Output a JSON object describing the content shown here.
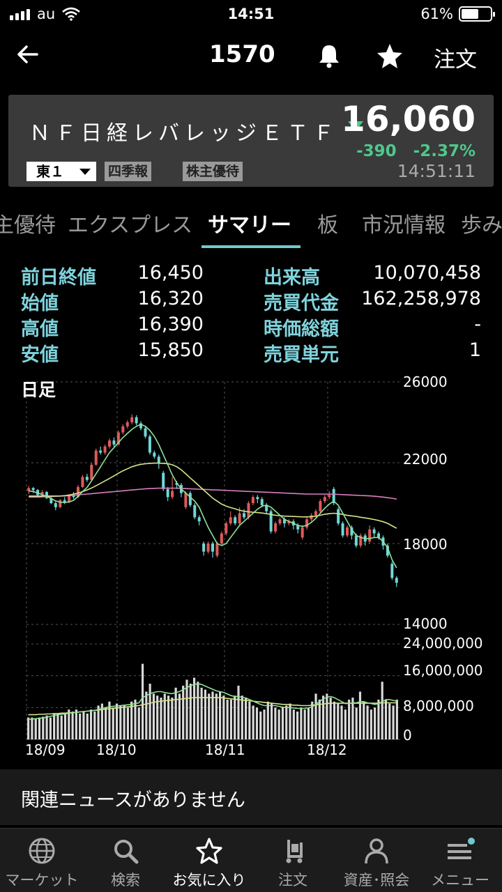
{
  "status_bar": {
    "carrier": "au",
    "time": "14:51",
    "battery": "61%",
    "battery_level": 0.61
  },
  "nav": {
    "code": "1570",
    "order_label": "注文"
  },
  "stock": {
    "name": "ＮＦ日経レバレッジＥＴＦ",
    "price": "16,060",
    "change": "-390",
    "change_pct": "-2.37%",
    "timestamp": "14:51:11",
    "market": "東１",
    "tags": [
      "四季報",
      "株主優待"
    ],
    "down_color": "#4fc88e"
  },
  "tabs": [
    "主優待",
    "エクスプレス",
    "サマリー",
    "板",
    "市況情報",
    "歩み"
  ],
  "active_tab": "サマリー",
  "summary": {
    "left": [
      {
        "label": "前日終値",
        "value": "16,450"
      },
      {
        "label": "始値",
        "value": "16,320"
      },
      {
        "label": "高値",
        "value": "16,390"
      },
      {
        "label": "安値",
        "value": "15,850"
      }
    ],
    "right": [
      {
        "label": "出来高",
        "value": "10,070,458"
      },
      {
        "label": "売買代金",
        "value": "162,258,978"
      },
      {
        "label": "時価総額",
        "value": "-"
      },
      {
        "label": "売買単元",
        "value": "1"
      }
    ]
  },
  "chart_data": {
    "type": "candlestick",
    "title": "日足",
    "price_ticks": [
      "26000",
      "22000",
      "18000",
      "14000"
    ],
    "price_ylim": [
      14000,
      26000
    ],
    "volume_ticks": [
      "24,000,000",
      "16,000,000",
      "8,000,000",
      "0"
    ],
    "volume_ylim": [
      0,
      24000000
    ],
    "x_labels": [
      "18/09",
      "18/10",
      "18/11",
      "18/12"
    ],
    "up_color": "#e05a5a",
    "down_color": "#72d6d6",
    "ma_colors": [
      "#8fe39a",
      "#d8e48a",
      "#d97fbf"
    ],
    "candles": [
      {
        "o": 20600,
        "c": 20750,
        "h": 20850,
        "l": 20450
      },
      {
        "o": 20750,
        "c": 20650,
        "h": 20800,
        "l": 20500
      },
      {
        "o": 20650,
        "c": 20400,
        "h": 20700,
        "l": 20300
      },
      {
        "o": 20400,
        "c": 20550,
        "h": 20650,
        "l": 20350
      },
      {
        "o": 20550,
        "c": 20250,
        "h": 20600,
        "l": 20200
      },
      {
        "o": 20250,
        "c": 20000,
        "h": 20300,
        "l": 19950
      },
      {
        "o": 20000,
        "c": 19800,
        "h": 20100,
        "l": 19650
      },
      {
        "o": 19800,
        "c": 20150,
        "h": 20200,
        "l": 19750
      },
      {
        "o": 20150,
        "c": 20050,
        "h": 20300,
        "l": 19950
      },
      {
        "o": 20050,
        "c": 20400,
        "h": 20450,
        "l": 20000
      },
      {
        "o": 20400,
        "c": 20300,
        "h": 20550,
        "l": 20200
      },
      {
        "o": 20300,
        "c": 20800,
        "h": 20900,
        "l": 20250
      },
      {
        "o": 20800,
        "c": 21300,
        "h": 21400,
        "l": 20750
      },
      {
        "o": 21300,
        "c": 21150,
        "h": 21450,
        "l": 21050
      },
      {
        "o": 21150,
        "c": 21900,
        "h": 22000,
        "l": 21100
      },
      {
        "o": 21900,
        "c": 22600,
        "h": 22700,
        "l": 21850
      },
      {
        "o": 22600,
        "c": 22500,
        "h": 22800,
        "l": 22400
      },
      {
        "o": 22500,
        "c": 22800,
        "h": 22900,
        "l": 22400
      },
      {
        "o": 22800,
        "c": 23100,
        "h": 23200,
        "l": 22700
      },
      {
        "o": 23100,
        "c": 22900,
        "h": 23250,
        "l": 22800
      },
      {
        "o": 22900,
        "c": 23500,
        "h": 23600,
        "l": 22850
      },
      {
        "o": 23500,
        "c": 23800,
        "h": 23900,
        "l": 23400
      },
      {
        "o": 23800,
        "c": 24000,
        "h": 24100,
        "l": 23700
      },
      {
        "o": 24000,
        "c": 24250,
        "h": 24400,
        "l": 23900
      },
      {
        "o": 24250,
        "c": 23950,
        "h": 24350,
        "l": 23850
      },
      {
        "o": 23950,
        "c": 23700,
        "h": 24050,
        "l": 23600
      },
      {
        "o": 23700,
        "c": 23300,
        "h": 23800,
        "l": 23200
      },
      {
        "o": 23300,
        "c": 22500,
        "h": 23400,
        "l": 22400
      },
      {
        "o": 22500,
        "c": 22300,
        "h": 22600,
        "l": 22200
      },
      {
        "o": 22300,
        "c": 22000,
        "h": 22400,
        "l": 21700
      },
      {
        "o": 21500,
        "c": 20700,
        "h": 21600,
        "l": 20600
      },
      {
        "o": 20700,
        "c": 20300,
        "h": 20800,
        "l": 20100
      },
      {
        "o": 20300,
        "c": 20600,
        "h": 21300,
        "l": 20200
      },
      {
        "o": 21000,
        "c": 20900,
        "h": 21100,
        "l": 20700
      },
      {
        "o": 20900,
        "c": 20500,
        "h": 21000,
        "l": 20300
      },
      {
        "o": 19800,
        "c": 20500,
        "h": 20600,
        "l": 19700
      },
      {
        "o": 20500,
        "c": 19900,
        "h": 20600,
        "l": 19800
      },
      {
        "o": 19900,
        "c": 19300,
        "h": 20000,
        "l": 19200
      },
      {
        "o": 19300,
        "c": 19100,
        "h": 19400,
        "l": 18900
      },
      {
        "o": 18000,
        "c": 17600,
        "h": 18100,
        "l": 17400
      },
      {
        "o": 17600,
        "c": 18000,
        "h": 18100,
        "l": 17500
      },
      {
        "o": 18000,
        "c": 17600,
        "h": 18100,
        "l": 17300
      },
      {
        "o": 17400,
        "c": 18000,
        "h": 18100,
        "l": 17300
      },
      {
        "o": 18000,
        "c": 18500,
        "h": 18600,
        "l": 17900
      },
      {
        "o": 18500,
        "c": 19000,
        "h": 19100,
        "l": 18400
      },
      {
        "o": 19000,
        "c": 19300,
        "h": 19600,
        "l": 18900
      },
      {
        "o": 19300,
        "c": 19000,
        "h": 19400,
        "l": 18900
      },
      {
        "o": 19000,
        "c": 19500,
        "h": 19800,
        "l": 18900
      },
      {
        "o": 19500,
        "c": 19300,
        "h": 19700,
        "l": 19200
      },
      {
        "o": 19300,
        "c": 20000,
        "h": 20100,
        "l": 19200
      },
      {
        "o": 20000,
        "c": 20300,
        "h": 20400,
        "l": 19900
      },
      {
        "o": 20300,
        "c": 20200,
        "h": 20400,
        "l": 20000
      },
      {
        "o": 20200,
        "c": 19900,
        "h": 20300,
        "l": 19800
      },
      {
        "o": 19900,
        "c": 19600,
        "h": 20000,
        "l": 19500
      },
      {
        "o": 19600,
        "c": 18600,
        "h": 19700,
        "l": 18500
      },
      {
        "o": 18600,
        "c": 19000,
        "h": 19100,
        "l": 18500
      },
      {
        "o": 19000,
        "c": 19200,
        "h": 19300,
        "l": 18900
      },
      {
        "o": 19200,
        "c": 19000,
        "h": 19300,
        "l": 18800
      },
      {
        "o": 19000,
        "c": 19100,
        "h": 19200,
        "l": 18900
      },
      {
        "o": 19100,
        "c": 18900,
        "h": 19200,
        "l": 18700
      },
      {
        "o": 18900,
        "c": 18700,
        "h": 19000,
        "l": 18500
      },
      {
        "o": 18300,
        "c": 18800,
        "h": 18900,
        "l": 18200
      },
      {
        "o": 18800,
        "c": 19200,
        "h": 19300,
        "l": 18700
      },
      {
        "o": 19200,
        "c": 19400,
        "h": 19500,
        "l": 19100
      },
      {
        "o": 19400,
        "c": 19600,
        "h": 19700,
        "l": 19300
      },
      {
        "o": 19600,
        "c": 20100,
        "h": 20200,
        "l": 19500
      },
      {
        "o": 20100,
        "c": 20300,
        "h": 20400,
        "l": 20000
      },
      {
        "o": 20300,
        "c": 20400,
        "h": 20600,
        "l": 20200
      },
      {
        "o": 20700,
        "c": 20000,
        "h": 20800,
        "l": 19900
      },
      {
        "o": 19700,
        "c": 19000,
        "h": 19800,
        "l": 18900
      },
      {
        "o": 19000,
        "c": 18400,
        "h": 19100,
        "l": 18300
      },
      {
        "o": 18400,
        "c": 18800,
        "h": 18900,
        "l": 18300
      },
      {
        "o": 18800,
        "c": 18400,
        "h": 18900,
        "l": 18200
      },
      {
        "o": 18400,
        "c": 17900,
        "h": 18500,
        "l": 17800
      },
      {
        "o": 17900,
        "c": 18400,
        "h": 18500,
        "l": 17800
      },
      {
        "o": 18400,
        "c": 18100,
        "h": 18500,
        "l": 17900
      },
      {
        "o": 18100,
        "c": 18700,
        "h": 18900,
        "l": 18000
      },
      {
        "o": 18700,
        "c": 18500,
        "h": 18800,
        "l": 18300
      },
      {
        "o": 18500,
        "c": 18300,
        "h": 18600,
        "l": 18200
      },
      {
        "o": 18300,
        "c": 17900,
        "h": 18400,
        "l": 17700
      },
      {
        "o": 17900,
        "c": 17400,
        "h": 18000,
        "l": 17300
      },
      {
        "o": 17000,
        "c": 16300,
        "h": 17100,
        "l": 16200
      },
      {
        "o": 16300,
        "c": 16060,
        "h": 16390,
        "l": 15850
      }
    ],
    "ma5": [
      20600,
      20580,
      20500,
      20420,
      20330,
      20230,
      20110,
      20050,
      20030,
      20060,
      20140,
      20330,
      20570,
      20780,
      21100,
      21450,
      21800,
      22150,
      22500,
      22750,
      23000,
      23250,
      23450,
      23650,
      23800,
      23900,
      23800,
      23600,
      23300,
      22900,
      22400,
      21900,
      21400,
      21000,
      20700,
      20500,
      20300,
      20100,
      19800,
      19300,
      18800,
      18400,
      18000,
      17900,
      18000,
      18300,
      18600,
      18900,
      19100,
      19300,
      19500,
      19700,
      19850,
      19900,
      19800,
      19600,
      19400,
      19200,
      19100,
      19000,
      18900,
      18850,
      18900,
      19050,
      19250,
      19500,
      19750,
      19950,
      20100,
      19900,
      19500,
      19100,
      18700,
      18400,
      18300,
      18250,
      18250,
      18300,
      18300,
      18100,
      17800,
      17200,
      16800
    ],
    "ma25": [
      20350,
      20350,
      20350,
      20350,
      20350,
      20350,
      20350,
      20350,
      20370,
      20400,
      20450,
      20500,
      20570,
      20650,
      20750,
      20860,
      20980,
      21100,
      21220,
      21350,
      21480,
      21600,
      21700,
      21800,
      21870,
      21920,
      21950,
      21970,
      21980,
      21980,
      21970,
      21950,
      21900,
      21800,
      21650,
      21450,
      21250,
      21050,
      20850,
      20650,
      20450,
      20250,
      20100,
      19950,
      19850,
      19780,
      19720,
      19650,
      19600,
      19570,
      19550,
      19530,
      19510,
      19480,
      19440,
      19400,
      19380,
      19360,
      19350,
      19340,
      19330,
      19320,
      19320,
      19330,
      19360,
      19400,
      19450,
      19480,
      19500,
      19480,
      19440,
      19400,
      19370,
      19340,
      19300,
      19270,
      19230,
      19190,
      19140,
      19080,
      19000,
      18880,
      18760
    ],
    "ma75": [
      20300,
      20300,
      20300,
      20310,
      20320,
      20330,
      20340,
      20350,
      20360,
      20370,
      20390,
      20410,
      20430,
      20450,
      20470,
      20490,
      20510,
      20530,
      20550,
      20570,
      20590,
      20610,
      20630,
      20650,
      20670,
      20690,
      20710,
      20720,
      20730,
      20740,
      20740,
      20740,
      20740,
      20740,
      20730,
      20720,
      20710,
      20700,
      20690,
      20680,
      20670,
      20660,
      20650,
      20640,
      20630,
      20620,
      20610,
      20600,
      20590,
      20580,
      20570,
      20560,
      20550,
      20540,
      20530,
      20520,
      20510,
      20500,
      20490,
      20480,
      20470,
      20460,
      20450,
      20450,
      20450,
      20450,
      20450,
      20450,
      20440,
      20430,
      20420,
      20410,
      20400,
      20390,
      20380,
      20370,
      20360,
      20340,
      20320,
      20300,
      20270,
      20240,
      20200
    ],
    "volumes": [
      5.5,
      5.5,
      5.2,
      5.5,
      5.7,
      6.0,
      5.5,
      6.5,
      6.5,
      6.0,
      6.5,
      7.5,
      7.0,
      7.5,
      6.5,
      7.0,
      6.5,
      7.5,
      7.0,
      8.5,
      9.0,
      8.0,
      9.5,
      8.0,
      9.0,
      8.5,
      8.5,
      8.0,
      9.5,
      10.0,
      8.0,
      19.0,
      12.0,
      14.0,
      11.5,
      11.0,
      10.5,
      11.5,
      11.0,
      10.5,
      13.0,
      11.5,
      13.5,
      15.0,
      14.0,
      15.5,
      14.5,
      13.0,
      12.5,
      11.5,
      12.0,
      11.5,
      12.0,
      11.0,
      10.0,
      10.0,
      11.0,
      13.5,
      11.0,
      10.5,
      9.5,
      8.5,
      8.0,
      7.0,
      7.5,
      9.5,
      9.0,
      8.0,
      7.5,
      8.0,
      8.5,
      9.0,
      7.5,
      7.0,
      8.0,
      7.5,
      8.0,
      9.5,
      11.5,
      10.0,
      11.0,
      11.5,
      10.5,
      9.5,
      9.0,
      8.5,
      7.5,
      10.0,
      10.5,
      8.0,
      12.0,
      9.5,
      8.5,
      7.5,
      8.0,
      10.0,
      14.5,
      10.0,
      9.0,
      8.5,
      10.0
    ],
    "vol_ma_short": [
      5.0,
      5.1,
      5.2,
      5.3,
      5.4,
      5.6,
      5.8,
      6.0,
      6.2,
      6.3,
      6.4,
      6.6,
      6.7,
      6.8,
      6.9,
      7.0,
      7.1,
      7.2,
      7.3,
      7.5,
      7.8,
      8.0,
      8.2,
      8.3,
      8.4,
      8.5,
      8.6,
      8.7,
      8.8,
      9.0,
      9.2,
      10.5,
      11.0,
      11.5,
      11.8,
      12.0,
      12.0,
      11.8,
      11.6,
      11.5,
      11.8,
      12.0,
      12.5,
      13.0,
      13.5,
      13.8,
      14.0,
      13.8,
      13.4,
      13.0,
      12.6,
      12.2,
      12.0,
      11.8,
      11.4,
      11.0,
      10.8,
      10.8,
      10.6,
      10.4,
      10.0,
      9.6,
      9.2,
      8.8,
      8.5,
      8.5,
      8.5,
      8.5,
      8.3,
      8.1,
      8.0,
      8.0,
      7.9,
      7.8,
      7.8,
      7.8,
      7.9,
      8.2,
      8.8,
      9.5,
      10.2,
      10.6,
      10.8,
      10.5,
      10.0,
      9.5,
      9.0,
      9.0,
      9.2,
      9.2,
      9.5,
      9.5,
      9.2,
      9.0,
      8.8,
      9.0,
      9.5,
      10.0,
      10.0,
      9.8,
      9.6
    ],
    "vol_ma_long": [
      6.2,
      6.2,
      6.2,
      6.3,
      6.3,
      6.4,
      6.4,
      6.5,
      6.5,
      6.6,
      6.6,
      6.7,
      6.7,
      6.8,
      6.9,
      7.0,
      7.1,
      7.2,
      7.3,
      7.4,
      7.5,
      7.6,
      7.7,
      7.8,
      7.9,
      8.0,
      8.1,
      8.2,
      8.3,
      8.4,
      8.5,
      8.7,
      8.9,
      9.1,
      9.3,
      9.5,
      9.6,
      9.7,
      9.8,
      9.9,
      10.0,
      10.1,
      10.2,
      10.3,
      10.4,
      10.5,
      10.5,
      10.5,
      10.5,
      10.5,
      10.5,
      10.5,
      10.5,
      10.4,
      10.3,
      10.2,
      10.1,
      10.0,
      9.9,
      9.8,
      9.7,
      9.6,
      9.5,
      9.4,
      9.3,
      9.2,
      9.1,
      9.0,
      8.9,
      8.8,
      8.8,
      8.7,
      8.6,
      8.6,
      8.5,
      8.5,
      8.5,
      8.6,
      8.7,
      8.8,
      8.9,
      9.0,
      9.1,
      9.1,
      9.1,
      9.1,
      9.1,
      9.1,
      9.1,
      9.1,
      9.1,
      9.1,
      9.1,
      9.1,
      9.1,
      9.1,
      9.2,
      9.2,
      9.2,
      9.2,
      9.2
    ]
  },
  "news": {
    "text": "関連ニュースがありません"
  },
  "bottom_tabs": [
    {
      "label": "マーケット",
      "icon": "globe-icon"
    },
    {
      "label": "検索",
      "icon": "search-icon"
    },
    {
      "label": "お気に入り",
      "icon": "star-icon"
    },
    {
      "label": "注文",
      "icon": "cart-icon"
    },
    {
      "label": "資産･照会",
      "icon": "person-icon"
    },
    {
      "label": "メニュー",
      "icon": "menu-icon"
    }
  ],
  "active_bottom_tab": "お気に入り",
  "accent_color": "#72c9d0"
}
